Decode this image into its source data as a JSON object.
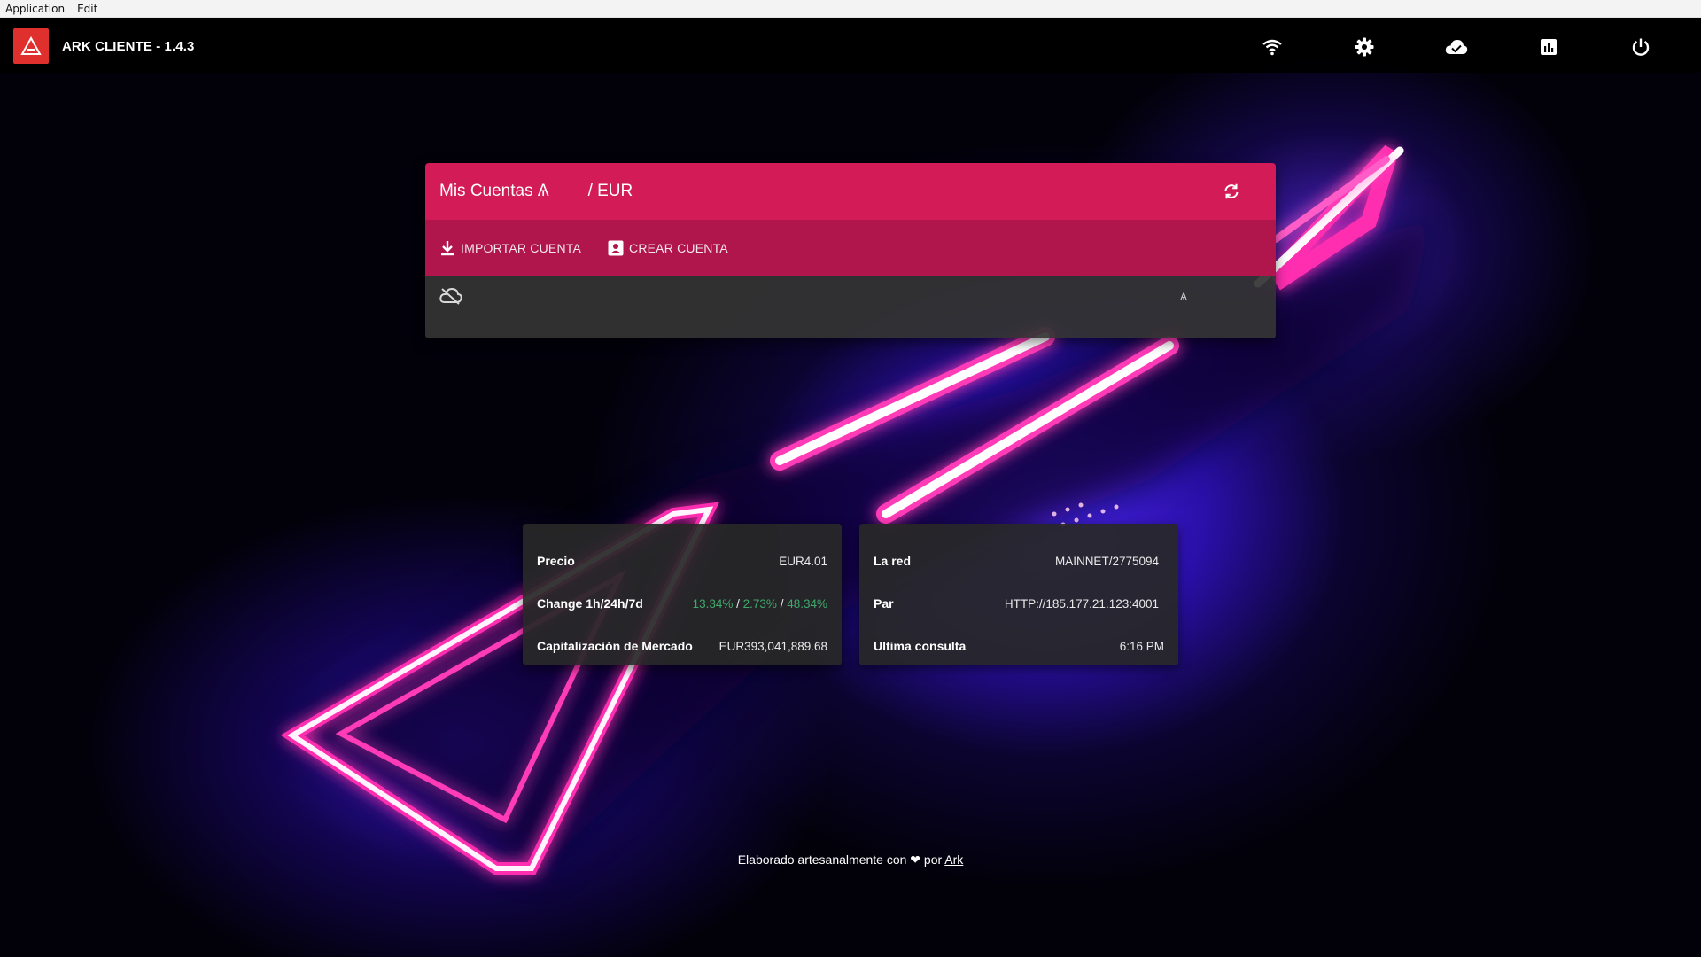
{
  "menubar": {
    "items": [
      "Application",
      "Edit"
    ]
  },
  "titlebar": {
    "title": "ARK CLIENTE - 1.4.3",
    "icons": [
      "wifi-icon",
      "gear-icon",
      "cloud-icon",
      "chart-icon",
      "power-icon"
    ]
  },
  "accounts": {
    "title": "Mis Cuentas Ѧ",
    "currency": "/ EUR",
    "import_label": "IMPORTAR CUENTA",
    "create_label": "CREAR CUENTA",
    "balance_symbol": "Ѧ"
  },
  "market": {
    "price_label": "Precio",
    "price_value": "EUR4.01",
    "change_label": "Change 1h/24h/7d",
    "change_1h": "13.34%",
    "change_24h": "2.73%",
    "change_7d": "48.34%",
    "separator": " / ",
    "cap_label": "Capitalización de Mercado",
    "cap_value": "EUR393,041,889.68"
  },
  "network": {
    "net_label": "La red",
    "net_value": "MAINNET/2775094",
    "peer_label": "Par",
    "peer_value": "HTTP://185.177.21.123:4001",
    "last_label": "Ultima consulta",
    "last_value": "6:16 PM"
  },
  "footer": {
    "prefix": "Elaborado artesanalmente con",
    "heart": "❤",
    "by": "por",
    "link": "Ark"
  },
  "colors": {
    "accent": "#d31c57",
    "accent_dark": "#b0164c",
    "logo": "#e0302e",
    "positive": "#3fa96a"
  }
}
